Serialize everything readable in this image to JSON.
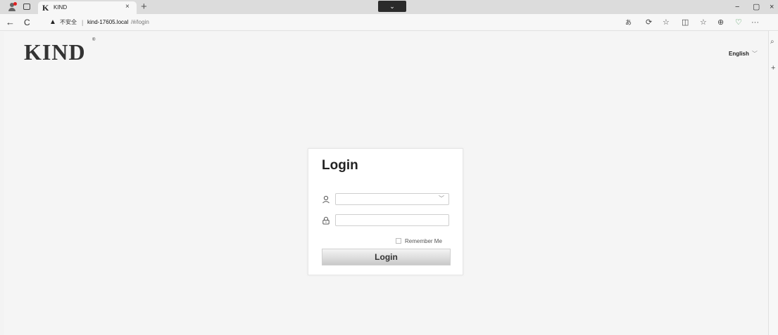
{
  "browser": {
    "tab": {
      "favicon": "K",
      "title": "KIND",
      "close": "×"
    },
    "new_tab": "+",
    "dropdown": "⌄",
    "window": {
      "minimize": "−",
      "restore": "▢",
      "close": "×"
    },
    "nav": {
      "back": "←",
      "refresh": "C"
    },
    "address": {
      "warning_icon": "▲",
      "insecure_label": "不安全",
      "separator": "|",
      "host": "kind-17605.local",
      "path": "/#/login"
    },
    "toolbar_icons": [
      "read-aloud-icon",
      "extensions-icon",
      "favorite-icon",
      "split-screen-icon",
      "favorites-bar-icon",
      "collections-icon",
      "performance-icon",
      "more-icon"
    ],
    "toolbar_glyphs": [
      "あ",
      "⟳",
      "☆",
      "◫",
      "☆",
      "⊕",
      "♡",
      "···"
    ],
    "side_panel": {
      "search": "⌕",
      "add": "+"
    }
  },
  "page": {
    "logo": "KIND",
    "logo_reg": "®",
    "language": {
      "selected": "English",
      "chevron": "﹀"
    },
    "login": {
      "title": "Login",
      "username_value": "",
      "password_value": "",
      "remember_label": "Remember Me",
      "remember_checked": false,
      "button_label": "Login"
    }
  }
}
